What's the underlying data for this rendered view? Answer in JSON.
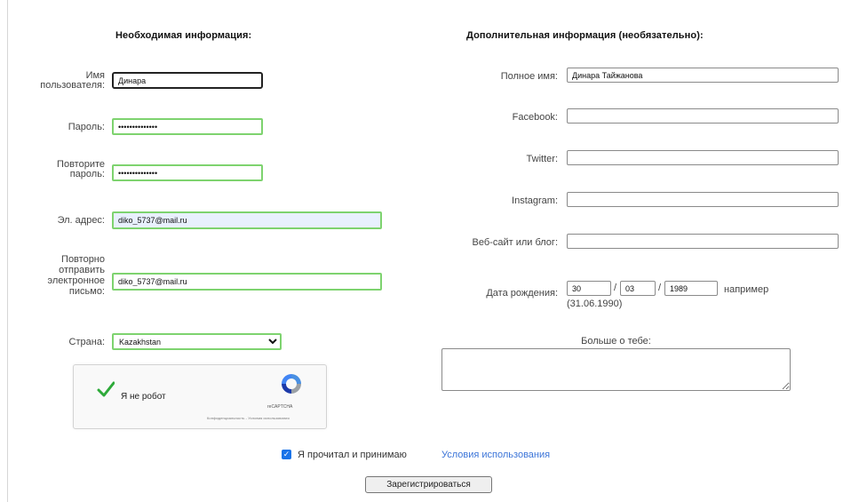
{
  "left": {
    "heading": "Необходимая информация:",
    "username": {
      "label_line1": "Имя",
      "label_line2": "пользователя:",
      "value": "Динара"
    },
    "password": {
      "label": "Пароль:",
      "value": "••••••••••••••"
    },
    "confirm_password": {
      "label_line1": "Повторите",
      "label_line2": "пароль:",
      "value": "••••••••••••••"
    },
    "email": {
      "label": "Эл. адрес:",
      "value": "diko_5737@mail.ru"
    },
    "confirm_email": {
      "label_line1": "Повторно",
      "label_line2": "отправить",
      "label_line3": "электронное",
      "label_line4": "письмо:",
      "value": "diko_5737@mail.ru"
    },
    "country": {
      "label": "Страна:",
      "selected": "Kazakhstan"
    }
  },
  "recaptcha": {
    "label": "Я не робот",
    "brand": "reCAPTCHA",
    "links": "Конфиденциальность - Условия использования"
  },
  "right": {
    "heading": "Дополнительная информация (необязательно):",
    "fullname": {
      "label": "Полное имя:",
      "value": "Динара Тайжанова"
    },
    "facebook": {
      "label": "Facebook:",
      "value": ""
    },
    "twitter": {
      "label": "Twitter:",
      "value": ""
    },
    "instagram": {
      "label": "Instagram:",
      "value": ""
    },
    "website": {
      "label": "Веб-сайт или блог:",
      "value": ""
    },
    "birthdate": {
      "label": "Дата рождения:",
      "day": "30",
      "month": "03",
      "year": "1989",
      "sep1": "/",
      "sep2": "/",
      "hint_line1": "например",
      "hint_line2": "(31.06.1990)"
    },
    "about_label": "Больше о тебе:"
  },
  "agree": {
    "text": "Я прочитал и принимаю",
    "link": "Условия использования",
    "checked": true
  },
  "submit_label": "Зарегистрироваться",
  "colors": {
    "valid_border": "#7ed36f",
    "link": "#3b74d8",
    "checkbox": "#1a73e8",
    "autofill": "#e8f0fe"
  }
}
